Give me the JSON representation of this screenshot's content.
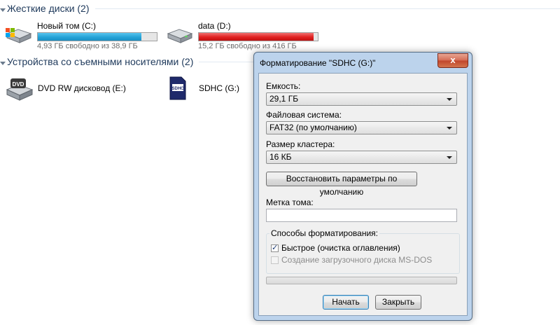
{
  "groups": {
    "hard_disks": "Жесткие диски (2)",
    "removable": "Устройства со съемными носителями (2)"
  },
  "drives": [
    {
      "name": "Новый том (C:)",
      "sub": "4,93 ГБ свободно из 38,9 ГБ",
      "used_fraction": 0.873,
      "color": "#25a3d7",
      "icon": "windows-drive-icon"
    },
    {
      "name": "data (D:)",
      "sub": "15,2 ГБ свободно из 416 ГБ",
      "used_fraction": 0.963,
      "color": "#e02020",
      "icon": "hard-drive-icon"
    }
  ],
  "removable_drives": [
    {
      "name": "DVD RW дисковод (E:)",
      "icon": "dvd-drive-icon",
      "icon_text": "DVD"
    },
    {
      "name": "SDHC (G:)",
      "icon": "sd-card-icon",
      "icon_text": "SDHC"
    }
  ],
  "dialog": {
    "title": "Форматирование \"SDHC (G:)\"",
    "close": "x",
    "capacity_label": "Емкость:",
    "capacity_value": "29,1 ГБ",
    "fs_label": "Файловая система:",
    "fs_value": "FAT32 (по умолчанию)",
    "cluster_label": "Размер кластера:",
    "cluster_value": "16 КБ",
    "restore_button": "Восстановить параметры по умолчанию",
    "volume_label": "Метка тома:",
    "volume_value": "",
    "format_options_label": "Способы форматирования:",
    "quick_format": "Быстрое (очистка оглавления)",
    "quick_checked": true,
    "msdos_boot": "Создание загрузочного диска MS-DOS",
    "msdos_checked": false,
    "start_button": "Начать",
    "close_button": "Закрыть",
    "progress": 0
  }
}
